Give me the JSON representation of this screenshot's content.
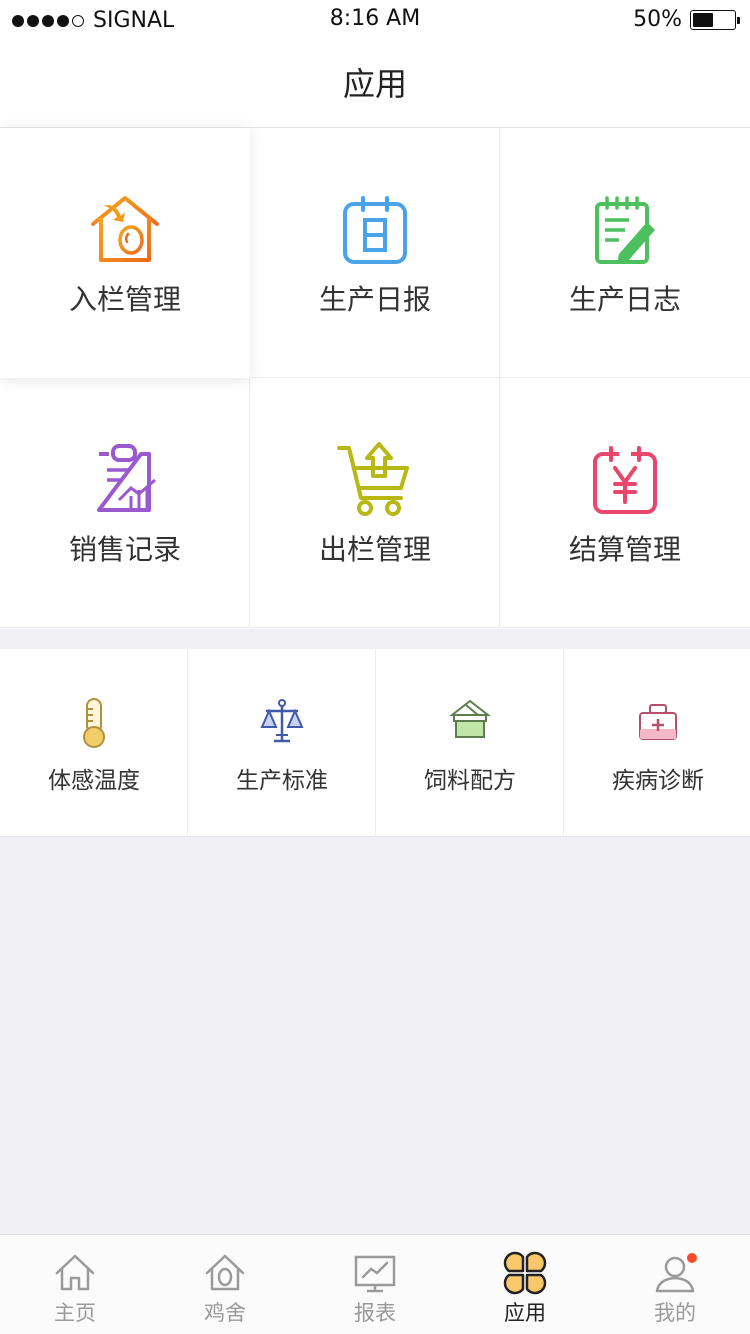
{
  "status_bar": {
    "carrier": "SIGNAL",
    "time": "8:16 AM",
    "battery": "50%",
    "battery_level": 0.5
  },
  "header": {
    "title": "应用"
  },
  "main_apps": [
    {
      "label": "入栏管理",
      "icon": "house-egg-icon",
      "color": "#f08a1c"
    },
    {
      "label": "生产日报",
      "icon": "calendar-icon",
      "color": "#4aa3e8"
    },
    {
      "label": "生产日志",
      "icon": "notepad-pencil-icon",
      "color": "#4cbf5f"
    },
    {
      "label": "销售记录",
      "icon": "clipboard-chart-icon",
      "color": "#9b59d0"
    },
    {
      "label": "出栏管理",
      "icon": "cart-upload-icon",
      "color": "#b8b814"
    },
    {
      "label": "结算管理",
      "icon": "yen-calendar-icon",
      "color": "#e8466a"
    }
  ],
  "tools": [
    {
      "label": "体感温度",
      "icon": "thermometer-icon",
      "color": "#c9a646"
    },
    {
      "label": "生产标准",
      "icon": "balance-scale-icon",
      "color": "#3f5aa8"
    },
    {
      "label": "饲料配方",
      "icon": "feed-box-icon",
      "color": "#7fb26a"
    },
    {
      "label": "疾病诊断",
      "icon": "medical-kit-icon",
      "color": "#c0566c"
    }
  ],
  "tab_bar": [
    {
      "label": "主页",
      "icon": "home-icon",
      "active": false
    },
    {
      "label": "鸡舍",
      "icon": "coop-icon",
      "active": false
    },
    {
      "label": "报表",
      "icon": "report-chart-icon",
      "active": false
    },
    {
      "label": "应用",
      "icon": "apps-grid-icon",
      "active": true
    },
    {
      "label": "我的",
      "icon": "profile-icon",
      "active": false,
      "badge": true
    }
  ]
}
